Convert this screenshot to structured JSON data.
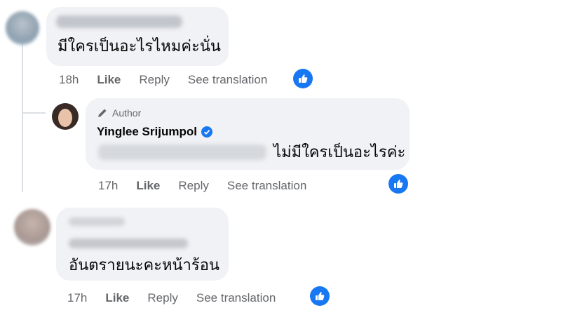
{
  "comments": [
    {
      "text": "มีใครเป็นอะไรไหมค่ะนั่น",
      "time": "18h",
      "like": "Like",
      "reply": "Reply",
      "translate": "See translation"
    },
    {
      "author_label": "Author",
      "author_name": "Yinglee Srijumpol",
      "text": "ไม่มีใครเป็นอะไรค่ะ",
      "time": "17h",
      "like": "Like",
      "reply": "Reply",
      "translate": "See translation"
    },
    {
      "text": "อันตรายนะคะหน้าร้อน",
      "time": "17h",
      "like": "Like",
      "reply": "Reply",
      "translate": "See translation"
    }
  ],
  "colors": {
    "accent": "#1877f2",
    "bubble": "#f0f2f5",
    "secondary_text": "#65676b"
  },
  "icons": [
    "like-thumb-icon",
    "pencil-icon",
    "verified-badge-icon"
  ]
}
